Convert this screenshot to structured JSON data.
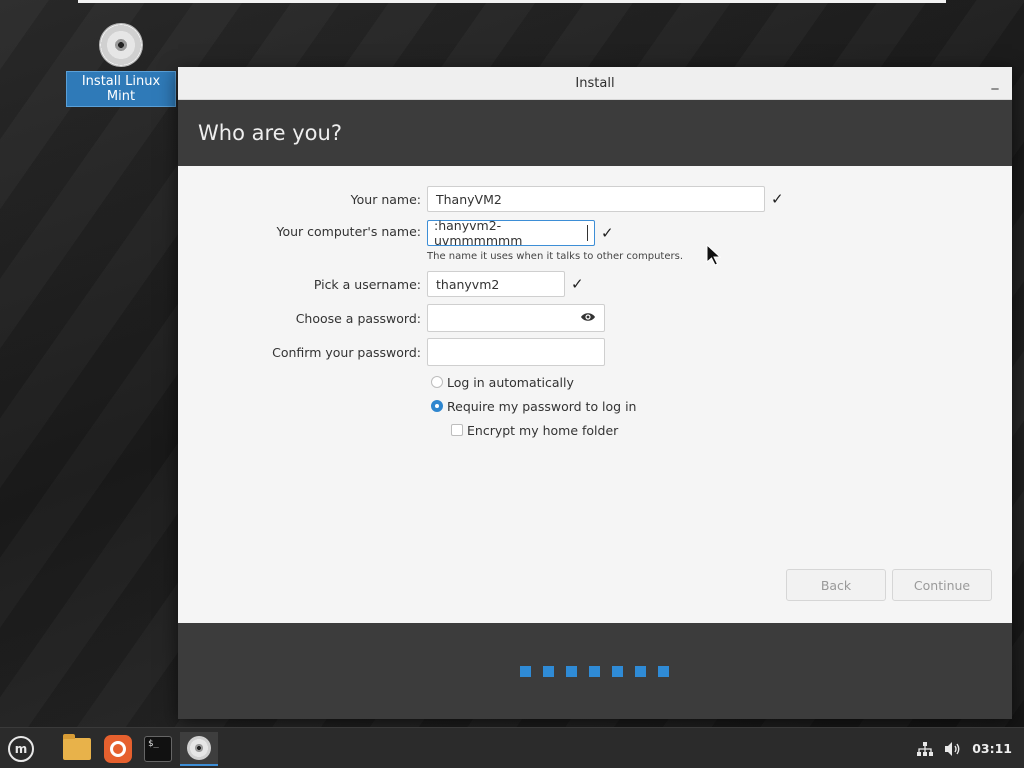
{
  "desktop": {
    "icon_label": "Install Linux Mint"
  },
  "window": {
    "title": "Install",
    "minimize_label": "_",
    "heading": "Who are you?"
  },
  "form": {
    "name": {
      "label": "Your name:",
      "value": "ThanyVM2"
    },
    "computer": {
      "label": "Your computer's name:",
      "value": ":hanyvm2-uvmmmmmm",
      "hint": "The name it uses when it talks to other computers."
    },
    "username": {
      "label": "Pick a username:",
      "value": "thanyvm2"
    },
    "password": {
      "label": "Choose a password:",
      "value": ""
    },
    "confirm": {
      "label": "Confirm your password:",
      "value": ""
    },
    "check_glyph": "✓",
    "login_auto": "Log in automatically",
    "require_password": "Require my password to log in",
    "encrypt_home": "Encrypt my home folder",
    "selected_login_option": "require_password",
    "encrypt_checked": false
  },
  "buttons": {
    "back": "Back",
    "continue": "Continue"
  },
  "progress": {
    "total_steps": 7,
    "color": "#2f8bd6"
  },
  "taskbar": {
    "mint_logo_text": "m",
    "terminal_prompt": "$_",
    "clock": "03:11",
    "icons": [
      "mint-menu-icon",
      "files-icon",
      "firefox-icon",
      "terminal-icon",
      "installer-disc-icon"
    ],
    "tray_icons": [
      "network-icon",
      "volume-icon"
    ]
  }
}
